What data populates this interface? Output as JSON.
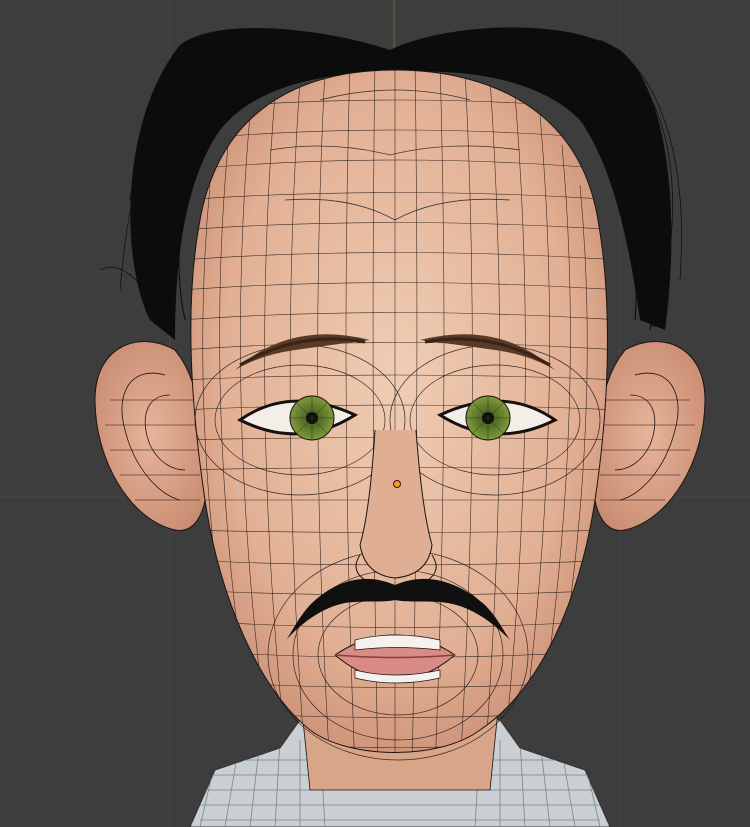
{
  "viewport": {
    "mode": "3d-viewport-wireframe-overlay",
    "subject": "stylized-head-model",
    "colors": {
      "background": "#3d3d3d",
      "grid_line": "#4a4a4a",
      "axis_line": "#6b6b3a",
      "skin": "#e9c2a6",
      "skin_shadow": "#c98d73",
      "wire": "#1c1412",
      "hair": "#0c0c0c",
      "iris": "#5e7a2a",
      "lips": "#d98c86",
      "shirt": "#c9cfd2",
      "origin": "#ff9a1f"
    }
  }
}
